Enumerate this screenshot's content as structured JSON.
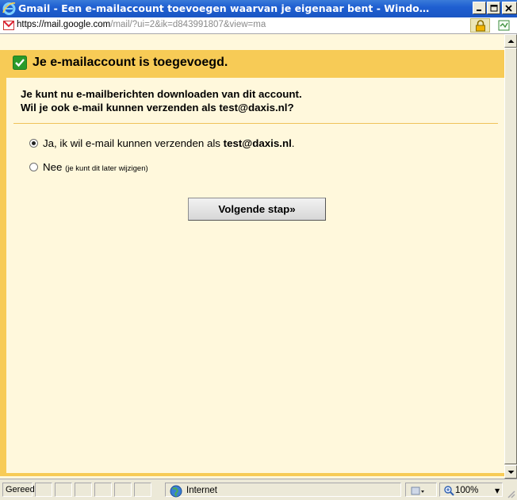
{
  "window": {
    "title": "Gmail - Een e-mailaccount toevoegen waarvan je eigenaar bent - Windows Internet...",
    "minimize_label": "_",
    "maximize_label": "□",
    "close_label": "X"
  },
  "address_bar": {
    "protocol": "https://",
    "host": "mail.google.com",
    "path": "/mail/?ui=2&ik=d843991807&view=ma"
  },
  "dialog": {
    "header": "Je e-mailaccount is toegevoegd.",
    "intro_line1": "Je kunt nu e-mailberichten downloaden van dit account.",
    "intro_line2": "Wil je ook e-mail kunnen verzenden als test@daxis.nl?",
    "option_yes_prefix": "Ja, ik wil e-mail kunnen verzenden als ",
    "option_yes_email": "test@daxis.nl",
    "option_yes_suffix": ".",
    "option_yes_selected": true,
    "option_no_label": "Nee",
    "option_no_note": "(je kunt dit later wijzigen)",
    "next_button": "Volgende stap»"
  },
  "status_bar": {
    "status": "Gereed",
    "zone": "Internet",
    "zoom": "100%"
  },
  "colors": {
    "titlebar": "#1f5fd1",
    "header_band": "#f7cb56",
    "content_bg": "#fff8dc",
    "divider": "#f0c25a"
  },
  "icons": {
    "ie": "ie-logo-icon",
    "gmail": "gmail-icon",
    "lock": "lock-icon",
    "check": "check-icon",
    "globe": "globe-icon",
    "zoom": "zoom-icon"
  }
}
